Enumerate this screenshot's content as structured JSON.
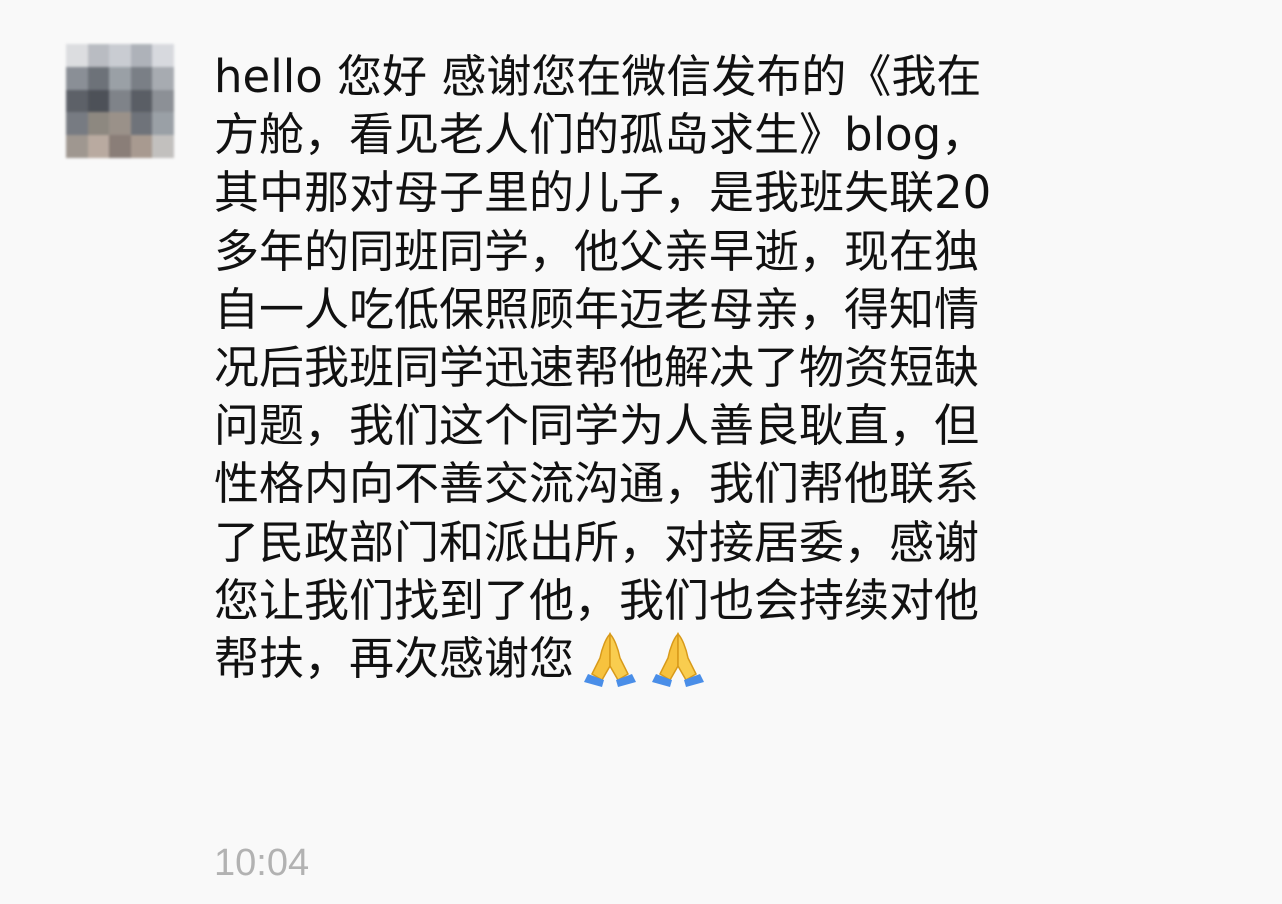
{
  "message": {
    "lines": [
      "hello 您好 感谢您在微信发布的《我在",
      "方舱，看见老人们的孤岛求生》blog，",
      "其中那对母子里的儿子，是我班失联20",
      "多年的同班同学，他父亲早逝，现在独",
      "自一人吃低保照顾年迈老母亲，得知情",
      "况后我班同学迅速帮他解决了物资短缺",
      "问题，我们这个同学为人善良耿直，但",
      "性格内向不善交流沟通，我们帮他联系",
      "了民政部门和派出所，对接居委，感谢",
      "您让我们找到了他，我们也会持续对他",
      "帮扶，再次感谢您"
    ],
    "emoji": [
      "folded-hands-icon",
      "folded-hands-icon"
    ],
    "timestamp": "10:04"
  },
  "colors": {
    "background": "#f9f9f9",
    "text": "#111111",
    "timestamp": "#b2b2b2",
    "emoji_skin": "#f7c23e",
    "emoji_sleeve": "#4a8ee8"
  }
}
